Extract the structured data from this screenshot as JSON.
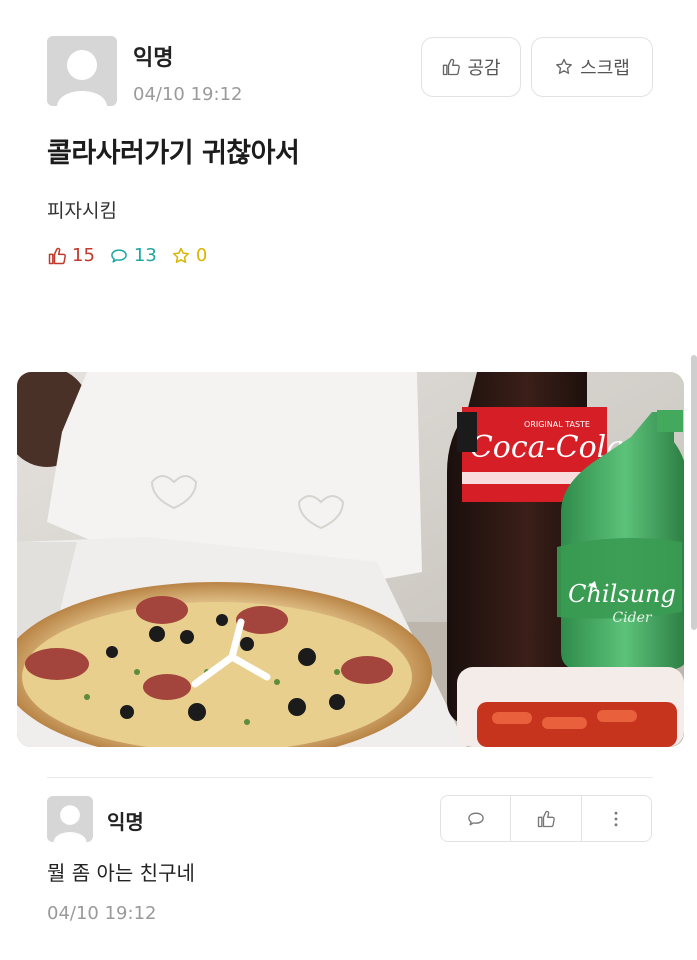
{
  "post": {
    "author": "익명",
    "time": "04/10 19:12",
    "title": "콜라사러가기 귀찮아서",
    "body": "피자시킴",
    "buttons": {
      "like_label": "공감",
      "scrap_label": "스크랩"
    },
    "stats": {
      "likes": "15",
      "comments": "13",
      "scraps": "0"
    },
    "stat_colors": {
      "likes": "#c0392b",
      "comments": "#1fa7a5",
      "scraps": "#d8b500"
    },
    "photo": {
      "coke_label": "Coca-Cola",
      "coke_badge": "ORIGINAL TASTE",
      "cider_label": "Chilsung",
      "cider_sub": "Cider"
    }
  },
  "comment": {
    "author": "익명",
    "text": "뭘 좀 아는 친구네",
    "time": "04/10 19:12"
  }
}
